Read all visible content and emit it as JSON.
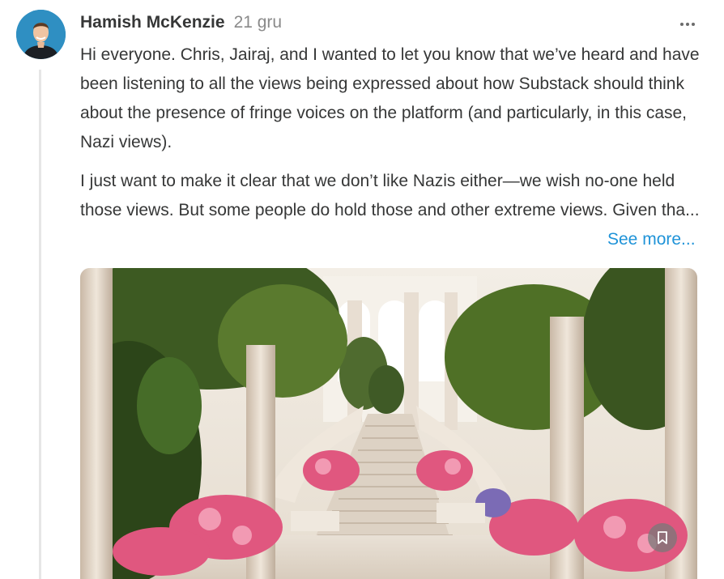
{
  "post": {
    "author": "Hamish McKenzie",
    "date": "21 gru",
    "paragraphs": [
      "Hi everyone. Chris, Jairaj, and I wanted to let you know that we’ve heard and have been listening to all the views being expressed about how Substack should think about the presence of fringe voices on the platform (and particularly, in this case, Nazi views).",
      "I just want to make it clear that we don’t like Nazis either—we wish no-one held those views. But some people do hold those and other extreme views. Given tha..."
    ],
    "see_more": "See more..."
  },
  "icons": {
    "more": "more-horizontal-icon",
    "bookmark": "bookmark-icon"
  },
  "colors": {
    "link": "#1f93d8",
    "text": "#363737",
    "muted": "#8a8a8a"
  }
}
